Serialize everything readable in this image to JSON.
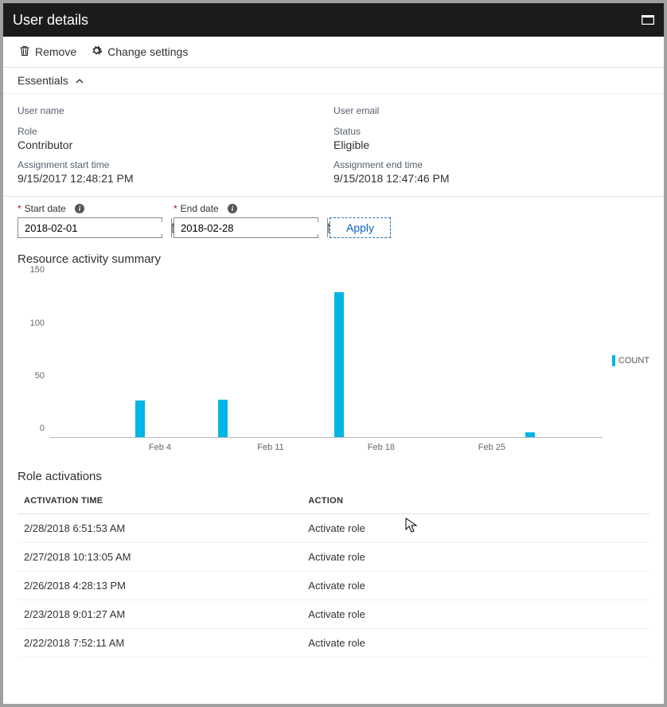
{
  "header": {
    "title": "User details"
  },
  "toolbar": {
    "remove_label": "Remove",
    "change_settings_label": "Change settings"
  },
  "essentials": {
    "header_label": "Essentials",
    "user_name_label": "User name",
    "user_name_value": "",
    "user_email_label": "User email",
    "user_email_value": "",
    "role_label": "Role",
    "role_value": "Contributor",
    "status_label": "Status",
    "status_value": "Eligible",
    "start_label": "Assignment start time",
    "start_value": "9/15/2017 12:48:21 PM",
    "end_label": "Assignment end time",
    "end_value": "9/15/2018 12:47:46 PM"
  },
  "filter": {
    "start_label": "Start date",
    "start_value": "2018-02-01",
    "end_label": "End date",
    "end_value": "2018-02-28",
    "apply_label": "Apply"
  },
  "summary": {
    "title": "Resource activity summary",
    "legend": "COUNT"
  },
  "chart_data": {
    "type": "bar",
    "title": "Resource activity summary",
    "xlabel": "",
    "ylabel": "",
    "ylim": [
      0,
      160
    ],
    "x_ticks": [
      "Feb 4",
      "Feb 11",
      "Feb 18",
      "Feb 25"
    ],
    "y_ticks": [
      0,
      50,
      100,
      150
    ],
    "series": [
      {
        "name": "COUNT",
        "points": [
          {
            "x_frac": 0.155,
            "value": 36
          },
          {
            "x_frac": 0.305,
            "value": 37
          },
          {
            "x_frac": 0.515,
            "value": 142
          },
          {
            "x_frac": 0.86,
            "value": 5
          }
        ]
      }
    ]
  },
  "activations": {
    "title": "Role activations",
    "columns": {
      "time": "ACTIVATION TIME",
      "action": "ACTION"
    },
    "rows": [
      {
        "time": "2/28/2018 6:51:53 AM",
        "action": "Activate role"
      },
      {
        "time": "2/27/2018 10:13:05 AM",
        "action": "Activate role"
      },
      {
        "time": "2/26/2018 4:28:13 PM",
        "action": "Activate role"
      },
      {
        "time": "2/23/2018 9:01:27 AM",
        "action": "Activate role"
      },
      {
        "time": "2/22/2018 7:52:11 AM",
        "action": "Activate role"
      }
    ]
  }
}
